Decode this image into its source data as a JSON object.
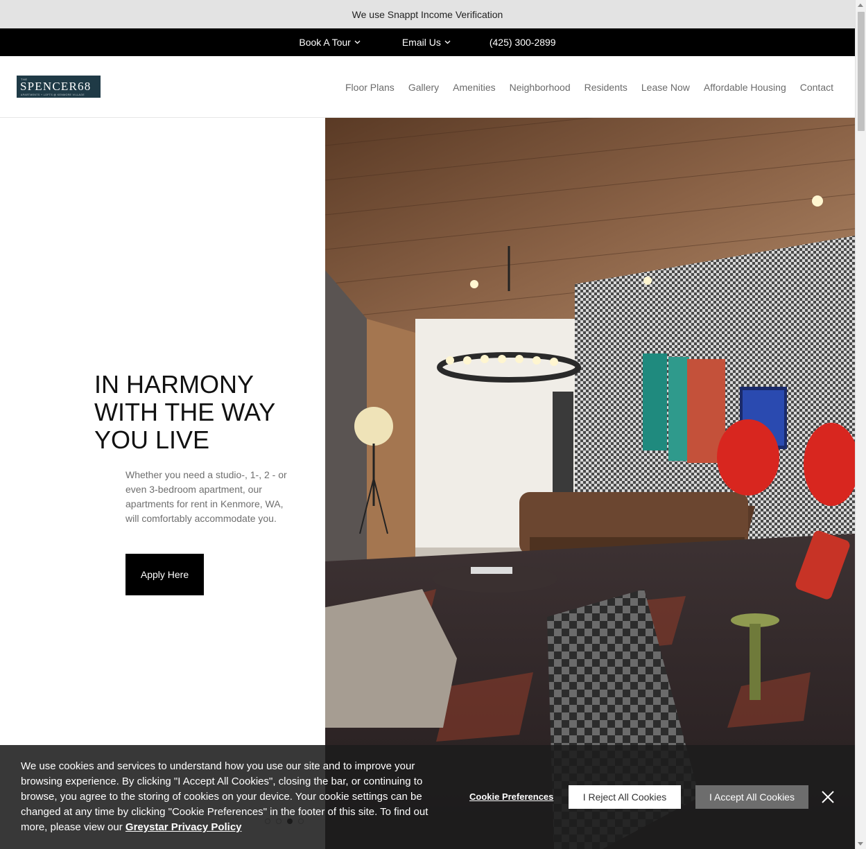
{
  "banner": {
    "text": "We use Snappt Income Verification"
  },
  "contact_bar": {
    "book_tour": "Book A Tour",
    "email_us": "Email Us",
    "phone": "(425) 300-2899"
  },
  "logo": {
    "the": "THE",
    "name": "SPENCER68",
    "tagline": "APARTMENTS + LOFTS @ KENMORE VILLAGE"
  },
  "nav": {
    "items": [
      {
        "label": "Floor Plans"
      },
      {
        "label": "Gallery"
      },
      {
        "label": "Amenities"
      },
      {
        "label": "Neighborhood"
      },
      {
        "label": "Residents"
      },
      {
        "label": "Lease Now"
      },
      {
        "label": "Affordable Housing"
      },
      {
        "label": "Contact"
      }
    ]
  },
  "hero": {
    "title": "IN HARMONY WITH THE WAY YOU LIVE",
    "description": "Whether you need a studio-, 1-, 2 - or even 3-bedroom apartment, our apartments for rent in Kenmore, WA, will comfortably accommodate you.",
    "cta": "Apply Here",
    "slides": {
      "count": 4,
      "active": 3
    }
  },
  "cookie": {
    "text": "We use cookies and services to understand how you use our site and to improve your browsing experience. By clicking \"I Accept All Cookies\", closing the bar, or continuing to browse, you agree to the storing of cookies on your device. Your cookie settings can be changed at any time by clicking \"Cookie Preferences\" in the footer of this site. To find out more, please view our",
    "link": "Greystar Privacy Policy",
    "preferences": "Cookie Preferences",
    "reject": "I Reject All Cookies",
    "accept": "I Accept All Cookies"
  },
  "colors": {
    "accent": "#000000",
    "logo_bg": "#1f3a46",
    "banner_bg": "#e3e3e3"
  }
}
